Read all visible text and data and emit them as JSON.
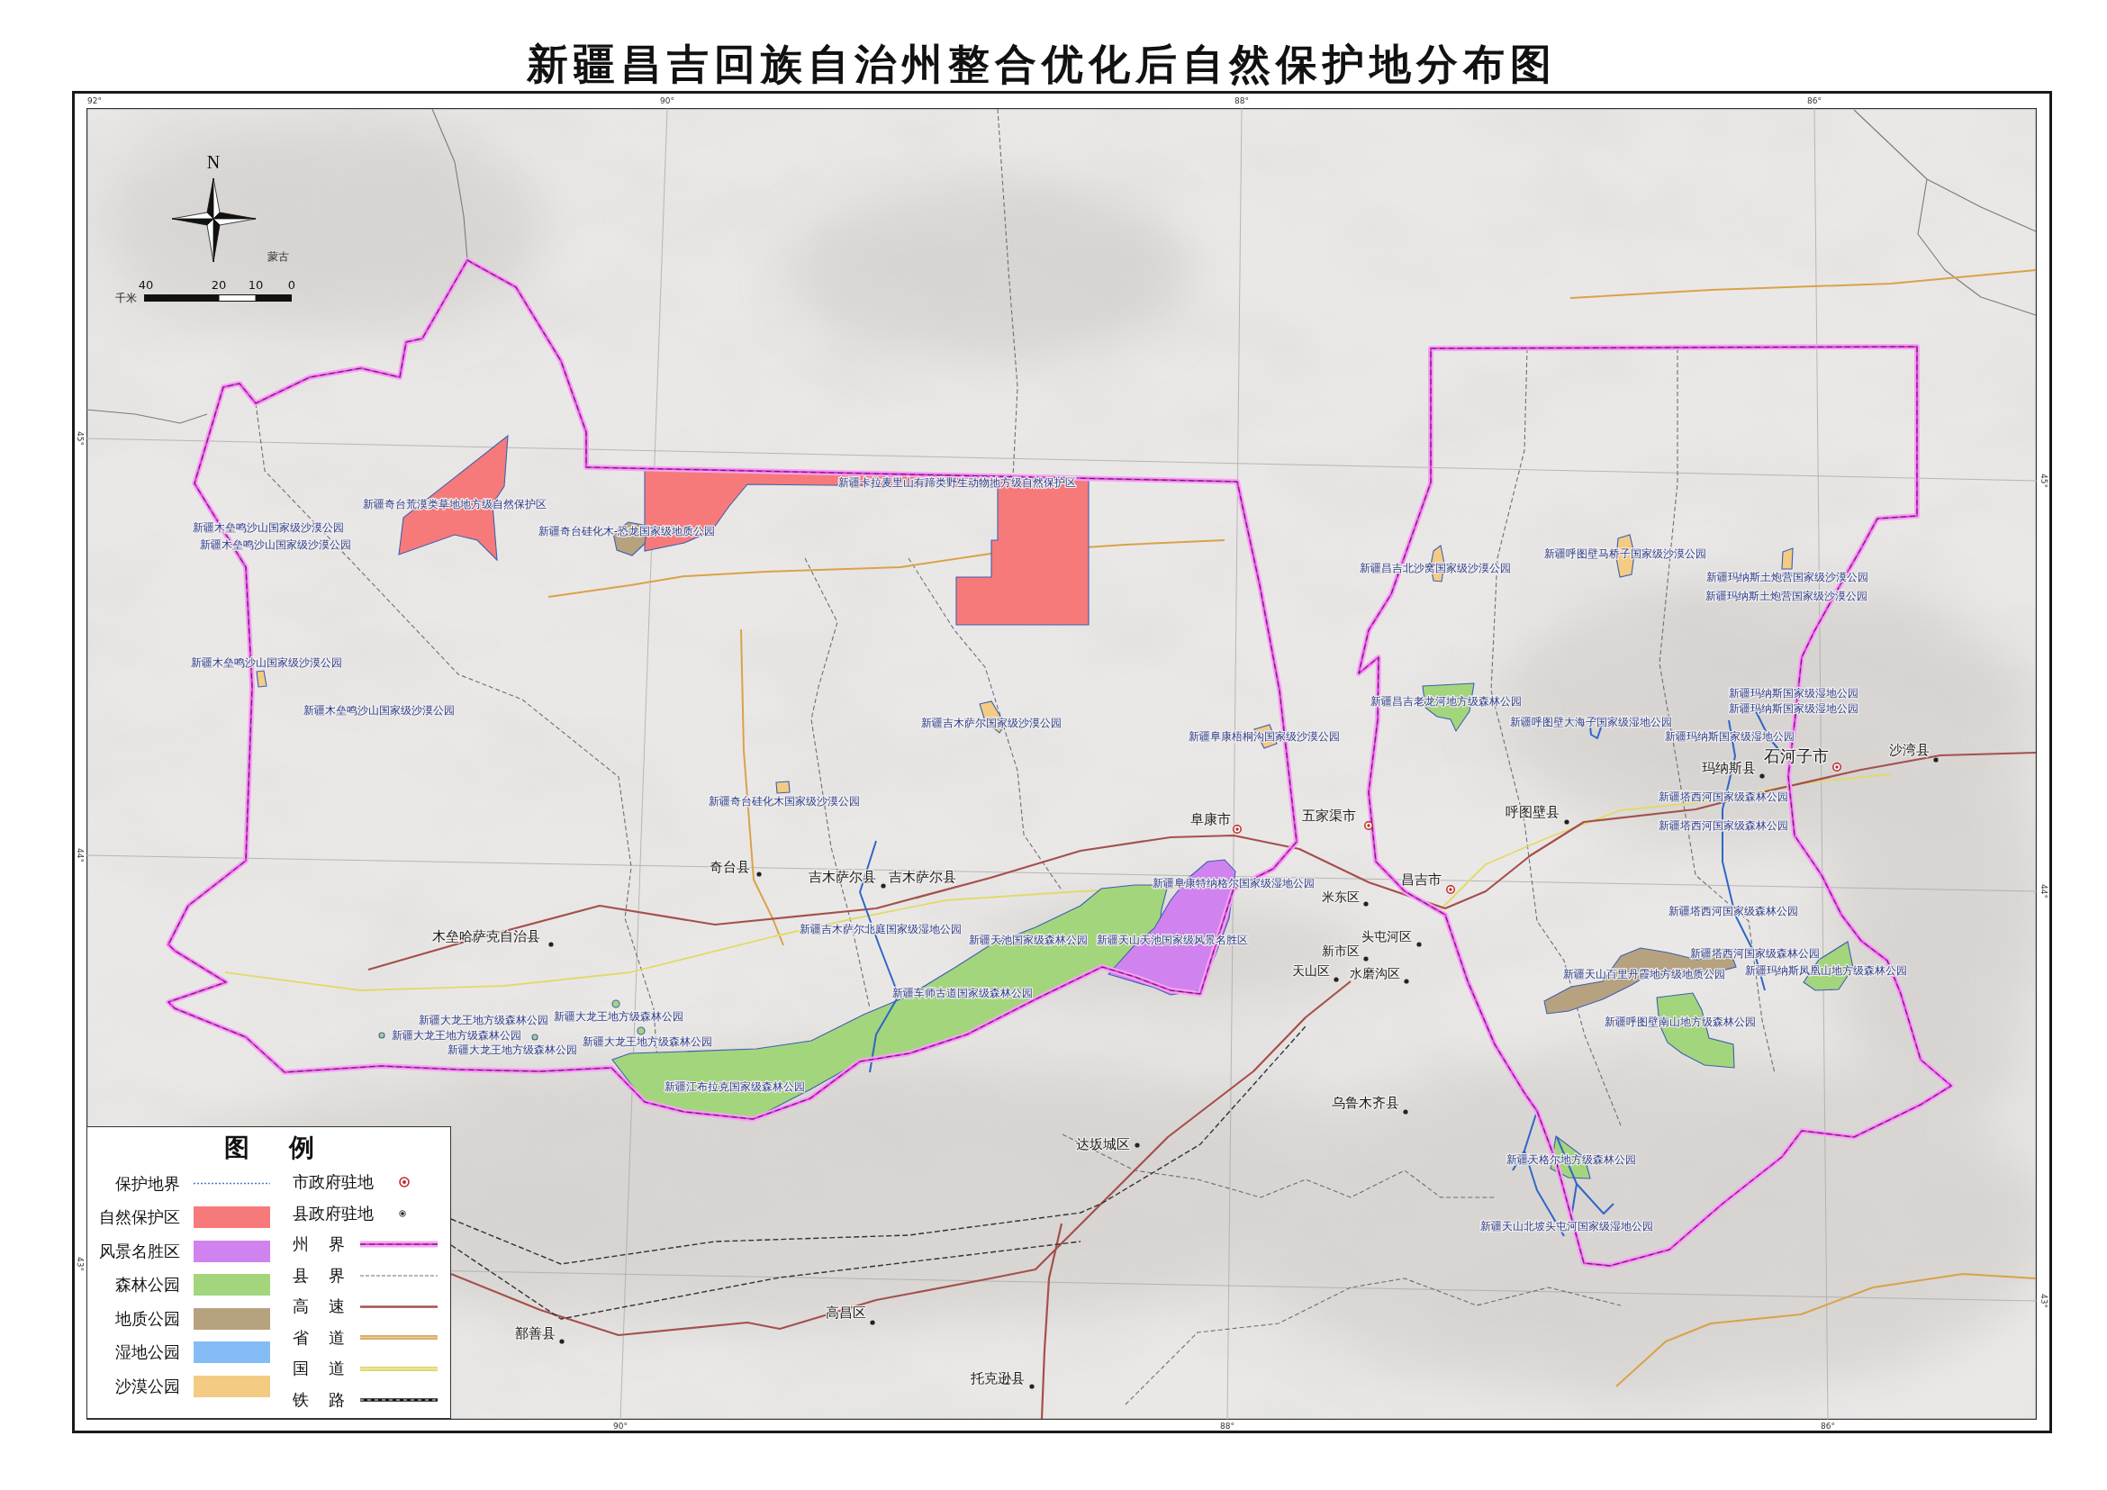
{
  "title": "新疆昌吉回族自治州整合优化后自然保护地分布图",
  "map": {
    "graticule_labels": [
      {
        "text": "92°",
        "kind": "horizontal"
      },
      {
        "text": "90°",
        "kind": "horizontal"
      },
      {
        "text": "88°",
        "kind": "horizontal"
      },
      {
        "text": "86°",
        "kind": "horizontal"
      },
      {
        "text": "45°",
        "kind": "vertical"
      },
      {
        "text": "45°",
        "kind": "vertical"
      },
      {
        "text": "44°",
        "kind": "vertical"
      },
      {
        "text": "44°",
        "kind": "vertical"
      },
      {
        "text": "43°",
        "kind": "vertical"
      },
      {
        "text": "43°",
        "kind": "vertical"
      },
      {
        "text": "90°",
        "kind": "horizontal"
      },
      {
        "text": "88°",
        "kind": "horizontal"
      },
      {
        "text": "86°",
        "kind": "horizontal"
      }
    ],
    "north_arrow": {
      "label": "N"
    },
    "scale_bar": {
      "ticks": [
        "40",
        "20",
        "10",
        "0"
      ],
      "unit": "千米"
    },
    "region_labels": [
      "蒙古"
    ],
    "places": [
      {
        "name": "玛纳斯县",
        "kind": "county"
      },
      {
        "name": "石河子市",
        "kind": "city"
      },
      {
        "name": "沙湾县",
        "kind": "county"
      },
      {
        "name": "阜康市",
        "kind": "city"
      },
      {
        "name": "五家渠市",
        "kind": "city"
      },
      {
        "name": "呼图壁县",
        "kind": "county"
      },
      {
        "name": "奇台县",
        "kind": "county"
      },
      {
        "name": "吉木萨尔县",
        "kind": "county"
      },
      {
        "name": "吉木萨尔县",
        "kind": "unmarked"
      },
      {
        "name": "昌吉市",
        "kind": "city"
      },
      {
        "name": "米东区",
        "kind": "county"
      },
      {
        "name": "木垒哈萨克自治县",
        "kind": "county"
      },
      {
        "name": "头屯河区",
        "kind": "county"
      },
      {
        "name": "新市区",
        "kind": "county"
      },
      {
        "name": "天山区",
        "kind": "county"
      },
      {
        "name": "水磨沟区",
        "kind": "county"
      },
      {
        "name": "乌鲁木齐县",
        "kind": "county"
      },
      {
        "name": "达坂城区",
        "kind": "county"
      },
      {
        "name": "高昌区",
        "kind": "county"
      },
      {
        "name": "鄯善县",
        "kind": "county"
      },
      {
        "name": "托克逊县",
        "kind": "county"
      }
    ],
    "protected_area_labels": [
      "新疆卡拉麦里山有蹄类野生动物地方级自然保护区",
      "新疆奇台荒漠类草地地方级自然保护区",
      "新疆木垒鸣沙山国家级沙漠公园",
      "新疆奇台硅化木-恐龙国家级地质公园",
      "新疆木垒鸣沙山国家级沙漠公园",
      "新疆呼图壁马桥子国家级沙漠公园",
      "新疆昌吉北沙窝国家级沙漠公园",
      "新疆玛纳斯土炮营国家级沙漠公园",
      "新疆玛纳斯土炮营国家级沙漠公园",
      "新疆木垒鸣沙山国家级沙漠公园",
      "新疆木垒鸣沙山国家级沙漠公园",
      "新疆昌吉老龙河地方级森林公园",
      "新疆玛纳斯国家级湿地公园",
      "新疆玛纳斯国家级湿地公园",
      "新疆吉木萨尔国家级沙漠公园",
      "新疆呼图壁大海子国家级湿地公园",
      "新疆阜康梧桐沟国家级沙漠公园",
      "新疆玛纳斯国家级湿地公园",
      "新疆奇台硅化木国家级沙漠公园",
      "新疆塔西河国家级森林公园",
      "新疆塔西河国家级森林公园",
      "新疆阜康特纳格尔国家级湿地公园",
      "新疆塔西河国家级森林公园",
      "新疆吉木萨尔北庭国家级湿地公园",
      "新疆天池国家级森林公园",
      "新疆天山天池国家级风景名胜区",
      "新疆塔西河国家级森林公园",
      "新疆天山百里丹霞地方级地质公园",
      "新疆玛纳斯凤凰山地方级森林公园",
      "新疆车师古道国家级森林公园",
      "新疆大龙王地方级森林公园",
      "新疆大龙王地方级森林公园",
      "新疆呼图壁南山地方级森林公园",
      "新疆大龙王地方级森林公园",
      "新疆大龙王地方级森林公园",
      "新疆大龙王地方级森林公园",
      "新疆江布拉克国家级森林公园",
      "新疆天格尔地方级森林公园",
      "新疆天山北坡头屯河国家级湿地公园"
    ]
  },
  "legend": {
    "title": "图例",
    "area_items": [
      {
        "label": "保护地界",
        "kind": "boundary"
      },
      {
        "label": "自然保护区",
        "kind": "fill",
        "color": "#f77a7a"
      },
      {
        "label": "风景名胜区",
        "kind": "fill",
        "color": "#d083ef"
      },
      {
        "label": "森林公园",
        "kind": "fill",
        "color": "#a3d57d"
      },
      {
        "label": "地质公园",
        "kind": "fill",
        "color": "#b7a27f"
      },
      {
        "label": "湿地公园",
        "kind": "fill",
        "color": "#85bcf5"
      },
      {
        "label": "沙漠公园",
        "kind": "fill",
        "color": "#f4cb82"
      }
    ],
    "symbol_items": [
      {
        "label": "市政府驻地",
        "kind": "city-seat"
      },
      {
        "label": "县政府驻地",
        "kind": "county-seat"
      },
      {
        "label": "州界",
        "kind": "prefecture-boundary"
      },
      {
        "label": "县界",
        "kind": "county-boundary"
      },
      {
        "label": "高速",
        "kind": "expressway"
      },
      {
        "label": "省道",
        "kind": "provincial-road"
      },
      {
        "label": "国道",
        "kind": "national-road"
      },
      {
        "label": "铁路",
        "kind": "railway"
      }
    ]
  }
}
